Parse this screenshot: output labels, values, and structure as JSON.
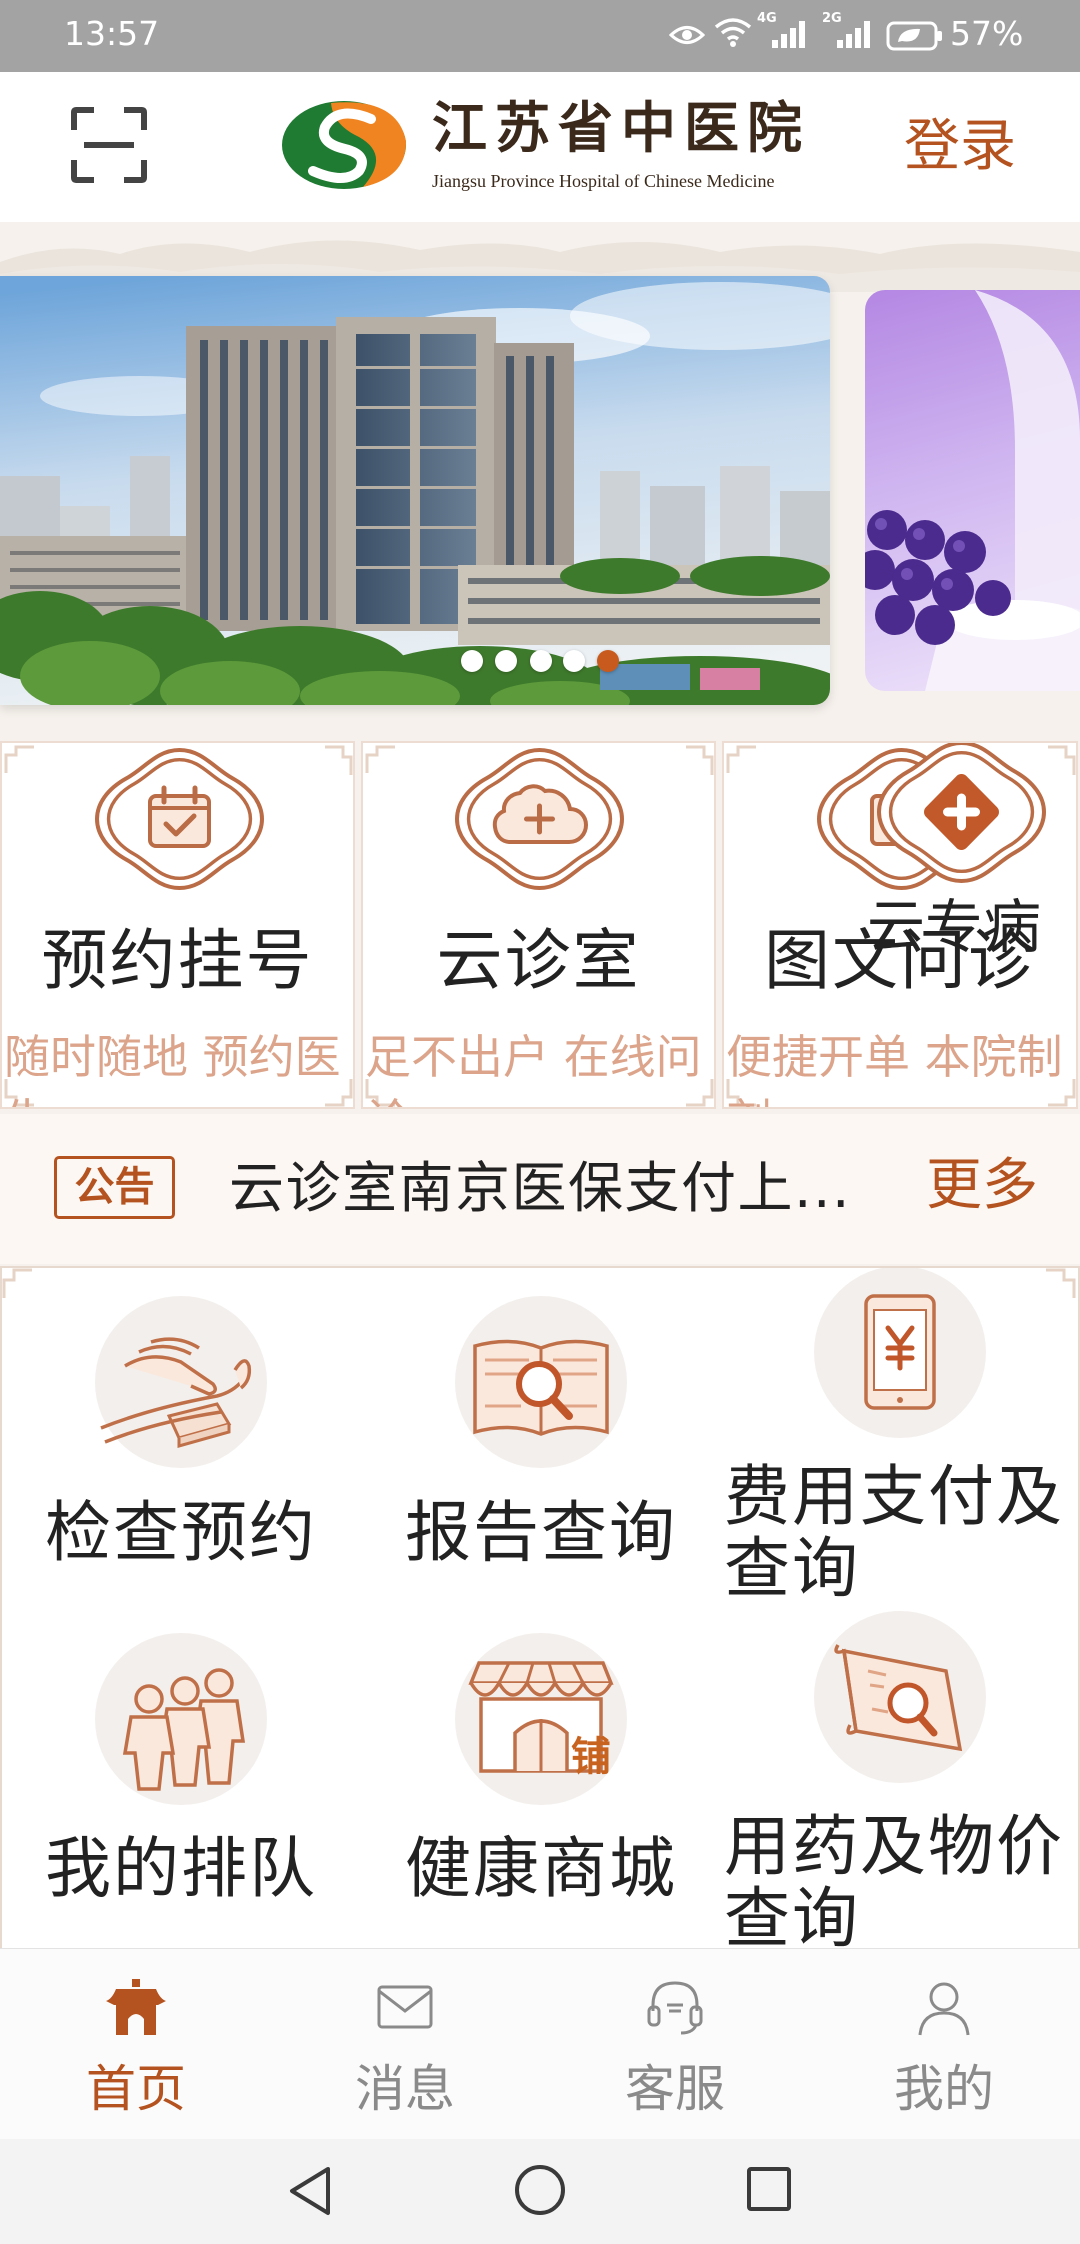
{
  "status_bar": {
    "time": "13:57",
    "net1": "4G",
    "net2": "2G",
    "battery": "57%"
  },
  "header": {
    "scan_icon": "scan-icon",
    "logo_cn": "江苏省中医院",
    "logo_en": "Jiangsu Province Hospital of Chinese Medicine",
    "login": "登录"
  },
  "banner": {
    "slides": 5,
    "active": 5
  },
  "services": [
    {
      "title": "预约挂号",
      "subtitle": "随时随地 预约医生",
      "icon": "calendar-check-icon"
    },
    {
      "title": "云诊室",
      "subtitle": "足不出户 在线问诊",
      "icon": "cloud-plus-icon"
    },
    {
      "title": "图文问诊",
      "subtitle": "便捷开单 本院制剂",
      "icon": "document-icon"
    }
  ],
  "services_overlay": {
    "title": "云专病",
    "icon": "medical-cross-icon"
  },
  "notice": {
    "tag": "公告",
    "text": "云诊室南京医保支付上...",
    "more": "更多"
  },
  "grid": [
    {
      "label": "检查预约",
      "icon": "pulse-diagnosis-icon"
    },
    {
      "label": "报告查询",
      "icon": "report-search-icon"
    },
    {
      "label": "费用支付及查询",
      "icon": "payment-phone-icon"
    },
    {
      "label": "我的排队",
      "icon": "queue-people-icon"
    },
    {
      "label": "健康商城",
      "icon": "shop-icon",
      "icon_text": "铺"
    },
    {
      "label": "用药及物价查询",
      "icon": "medicine-scroll-icon"
    }
  ],
  "tabbar": [
    {
      "label": "首页",
      "icon": "home-pagoda-icon",
      "active": true
    },
    {
      "label": "消息",
      "icon": "mail-icon",
      "active": false
    },
    {
      "label": "客服",
      "icon": "headset-icon",
      "active": false
    },
    {
      "label": "我的",
      "icon": "user-icon",
      "active": false
    }
  ],
  "system_nav": [
    "back-icon",
    "home-circle-icon",
    "recents-square-icon"
  ],
  "colors": {
    "accent": "#b4531f",
    "subtitle": "#dca58b",
    "icon_stroke": "#b96c46",
    "active_dot": "#c85a1e"
  }
}
